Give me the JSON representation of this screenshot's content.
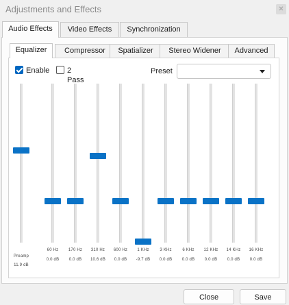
{
  "window": {
    "title": "Adjustments and Effects",
    "close_glyph": "✕"
  },
  "main_tabs": [
    {
      "label": "Audio Effects",
      "active": true
    },
    {
      "label": "Video Effects",
      "active": false
    },
    {
      "label": "Synchronization",
      "active": false
    }
  ],
  "sub_tabs": [
    {
      "label": "Equalizer",
      "active": true
    },
    {
      "label": "Compressor",
      "active": false
    },
    {
      "label": "Spatializer",
      "active": false
    },
    {
      "label": "Stereo Widener",
      "active": false
    },
    {
      "label": "Advanced",
      "active": false
    }
  ],
  "options": {
    "enable": {
      "label": "Enable",
      "checked": true
    },
    "two_pass": {
      "label": "2 Pass",
      "checked": false
    }
  },
  "preset": {
    "label": "Preset",
    "value": ""
  },
  "equalizer": {
    "range_db": [
      -20,
      20
    ],
    "preamp": {
      "name": "Preamp",
      "value_text": "11.9 dB",
      "value": 11.9
    },
    "bands": [
      {
        "freq": "60 Hz",
        "value_text": "0.0 dB",
        "value": 0.0
      },
      {
        "freq": "170 Hz",
        "value_text": "0.0 dB",
        "value": 0.0
      },
      {
        "freq": "310 Hz",
        "value_text": "10.6 dB",
        "value": 10.6
      },
      {
        "freq": "600 Hz",
        "value_text": "0.0 dB",
        "value": 0.0
      },
      {
        "freq": "1 KHz",
        "value_text": "-9.7 dB",
        "value": -9.7
      },
      {
        "freq": "3 KHz",
        "value_text": "0.0 dB",
        "value": 0.0
      },
      {
        "freq": "6 KHz",
        "value_text": "0.0 dB",
        "value": 0.0
      },
      {
        "freq": "12 KHz",
        "value_text": "0.0 dB",
        "value": 0.0
      },
      {
        "freq": "14 KHz",
        "value_text": "0.0 dB",
        "value": 0.0
      },
      {
        "freq": "16 KHz",
        "value_text": "0.0 dB",
        "value": 0.0
      }
    ]
  },
  "footer": {
    "close_label": "Close",
    "save_label": "Save"
  },
  "colors": {
    "accent": "#0a72c6",
    "checkbox": "#0067c0"
  }
}
